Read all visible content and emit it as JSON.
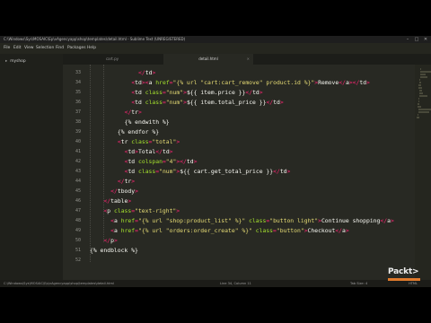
{
  "window": {
    "title": "C:\\Windows\\Sys\\MOSAIC\\Ep\\vAgencyapp\\shop\\templates\\detail.html - Sublime Text (UNREGISTERED)",
    "controls": [
      "–",
      "□",
      "✕"
    ]
  },
  "menu": [
    "File",
    "Edit",
    "View",
    "Selection",
    "Find",
    "Packages",
    "Help"
  ],
  "sidebar": {
    "folder": "myshop"
  },
  "tabs": [
    {
      "label": "cart.py",
      "active": false
    },
    {
      "label": "detail.html",
      "active": true
    }
  ],
  "editor": {
    "lines": [
      {
        "n": "33",
        "indent": 14,
        "segs": [
          [
            "t",
            "</"
          ],
          [
            "w",
            "td"
          ],
          [
            "t",
            ">"
          ]
        ]
      },
      {
        "n": "34",
        "indent": 12,
        "segs": [
          [
            "t",
            "<"
          ],
          [
            "w",
            "td"
          ],
          [
            "t",
            "><"
          ],
          [
            "w",
            "a "
          ],
          [
            "a",
            "href"
          ],
          [
            "t",
            "="
          ],
          [
            "s",
            "\"{% url \"cart:cart_remove\" product.id %}\""
          ],
          [
            "t",
            ">"
          ],
          [
            "w",
            "Remove"
          ],
          [
            "t",
            "</"
          ],
          [
            "w",
            "a"
          ],
          [
            "t",
            "></"
          ],
          [
            "w",
            "td"
          ],
          [
            "t",
            ">"
          ]
        ]
      },
      {
        "n": "35",
        "indent": 12,
        "segs": [
          [
            "t",
            "<"
          ],
          [
            "w",
            "td "
          ],
          [
            "a",
            "class"
          ],
          [
            "t",
            "="
          ],
          [
            "s",
            "\"num\""
          ],
          [
            "t",
            ">"
          ],
          [
            "w",
            "${{ item.price }}"
          ],
          [
            "t",
            "</"
          ],
          [
            "w",
            "td"
          ],
          [
            "t",
            ">"
          ]
        ]
      },
      {
        "n": "36",
        "indent": 12,
        "segs": [
          [
            "t",
            "<"
          ],
          [
            "w",
            "td "
          ],
          [
            "a",
            "class"
          ],
          [
            "t",
            "="
          ],
          [
            "s",
            "\"num\""
          ],
          [
            "t",
            ">"
          ],
          [
            "w",
            "${{ item.total_price }}"
          ],
          [
            "t",
            "</"
          ],
          [
            "w",
            "td"
          ],
          [
            "t",
            ">"
          ]
        ]
      },
      {
        "n": "37",
        "indent": 10,
        "segs": [
          [
            "t",
            "</"
          ],
          [
            "w",
            "tr"
          ],
          [
            "t",
            ">"
          ]
        ]
      },
      {
        "n": "38",
        "indent": 10,
        "segs": [
          [
            "w",
            "{% endwith %}"
          ]
        ]
      },
      {
        "n": "39",
        "indent": 8,
        "segs": [
          [
            "w",
            "{% endfor %}"
          ]
        ]
      },
      {
        "n": "40",
        "indent": 8,
        "segs": [
          [
            "t",
            "<"
          ],
          [
            "w",
            "tr "
          ],
          [
            "a",
            "class"
          ],
          [
            "t",
            "="
          ],
          [
            "s",
            "\"total\""
          ],
          [
            "t",
            ">"
          ]
        ]
      },
      {
        "n": "41",
        "indent": 10,
        "segs": [
          [
            "t",
            "<"
          ],
          [
            "w",
            "td"
          ],
          [
            "t",
            ">"
          ],
          [
            "w",
            "Total"
          ],
          [
            "t",
            "</"
          ],
          [
            "w",
            "td"
          ],
          [
            "t",
            ">"
          ]
        ]
      },
      {
        "n": "42",
        "indent": 10,
        "segs": [
          [
            "t",
            "<"
          ],
          [
            "w",
            "td "
          ],
          [
            "a",
            "colspan"
          ],
          [
            "t",
            "="
          ],
          [
            "s",
            "\"4\""
          ],
          [
            "t",
            "></"
          ],
          [
            "w",
            "td"
          ],
          [
            "t",
            ">"
          ]
        ]
      },
      {
        "n": "43",
        "indent": 10,
        "segs": [
          [
            "t",
            "<"
          ],
          [
            "w",
            "td "
          ],
          [
            "a",
            "class"
          ],
          [
            "t",
            "="
          ],
          [
            "s",
            "\"num\""
          ],
          [
            "t",
            ">"
          ],
          [
            "w",
            "${{ cart.get_total_price }}"
          ],
          [
            "t",
            "</"
          ],
          [
            "w",
            "td"
          ],
          [
            "t",
            ">"
          ]
        ]
      },
      {
        "n": "44",
        "indent": 8,
        "segs": [
          [
            "t",
            "</"
          ],
          [
            "w",
            "tr"
          ],
          [
            "t",
            ">"
          ]
        ]
      },
      {
        "n": "45",
        "indent": 6,
        "segs": [
          [
            "t",
            "</"
          ],
          [
            "w",
            "tbody"
          ],
          [
            "t",
            ">"
          ]
        ]
      },
      {
        "n": "46",
        "indent": 4,
        "segs": [
          [
            "t",
            "</"
          ],
          [
            "w",
            "table"
          ],
          [
            "t",
            ">"
          ]
        ]
      },
      {
        "n": "47",
        "indent": 4,
        "segs": [
          [
            "t",
            "<"
          ],
          [
            "w",
            "p "
          ],
          [
            "a",
            "class"
          ],
          [
            "t",
            "="
          ],
          [
            "s",
            "\"text-right\""
          ],
          [
            "t",
            ">"
          ]
        ]
      },
      {
        "n": "48",
        "indent": 6,
        "segs": [
          [
            "t",
            "<"
          ],
          [
            "w",
            "a "
          ],
          [
            "a",
            "href"
          ],
          [
            "t",
            "="
          ],
          [
            "s",
            "\"{% url \"shop:product_list\" %}\""
          ],
          [
            "w",
            " "
          ],
          [
            "a",
            "class"
          ],
          [
            "t",
            "="
          ],
          [
            "s",
            "\"button light\""
          ],
          [
            "t",
            ">"
          ],
          [
            "w",
            "Continue shopping"
          ],
          [
            "t",
            "</"
          ],
          [
            "w",
            "a"
          ],
          [
            "t",
            ">"
          ]
        ]
      },
      {
        "n": "49",
        "indent": 6,
        "segs": [
          [
            "t",
            "<"
          ],
          [
            "w",
            "a "
          ],
          [
            "a",
            "href"
          ],
          [
            "t",
            "="
          ],
          [
            "s",
            "\"{% url \"orders:order_create\" %}\""
          ],
          [
            "w",
            " "
          ],
          [
            "a",
            "class"
          ],
          [
            "t",
            "="
          ],
          [
            "s",
            "\"button\""
          ],
          [
            "t",
            ">"
          ],
          [
            "w",
            "Checkout"
          ],
          [
            "t",
            "</"
          ],
          [
            "w",
            "a"
          ],
          [
            "t",
            ">"
          ]
        ]
      },
      {
        "n": "50",
        "indent": 4,
        "segs": [
          [
            "t",
            "</"
          ],
          [
            "w",
            "p"
          ],
          [
            "t",
            ">"
          ]
        ]
      },
      {
        "n": "51",
        "indent": 0,
        "segs": [
          [
            "w",
            "{% endblock %}"
          ]
        ]
      },
      {
        "n": "52",
        "indent": 0,
        "segs": []
      }
    ]
  },
  "status": {
    "path": "C:\\Windows\\Sys\\MOSAIC\\Ep\\vAgencyapp\\shop\\templates\\detail.html",
    "position": "Line 34, Column 11",
    "indent": "Tab Size: 4",
    "syntax": "HTML"
  },
  "watermark": {
    "text": "Packt>"
  },
  "colors": {
    "tag": "#f92672",
    "attr": "#a6e22e",
    "string": "#e6db74",
    "text": "#f8f8f2",
    "background": "#282923"
  }
}
